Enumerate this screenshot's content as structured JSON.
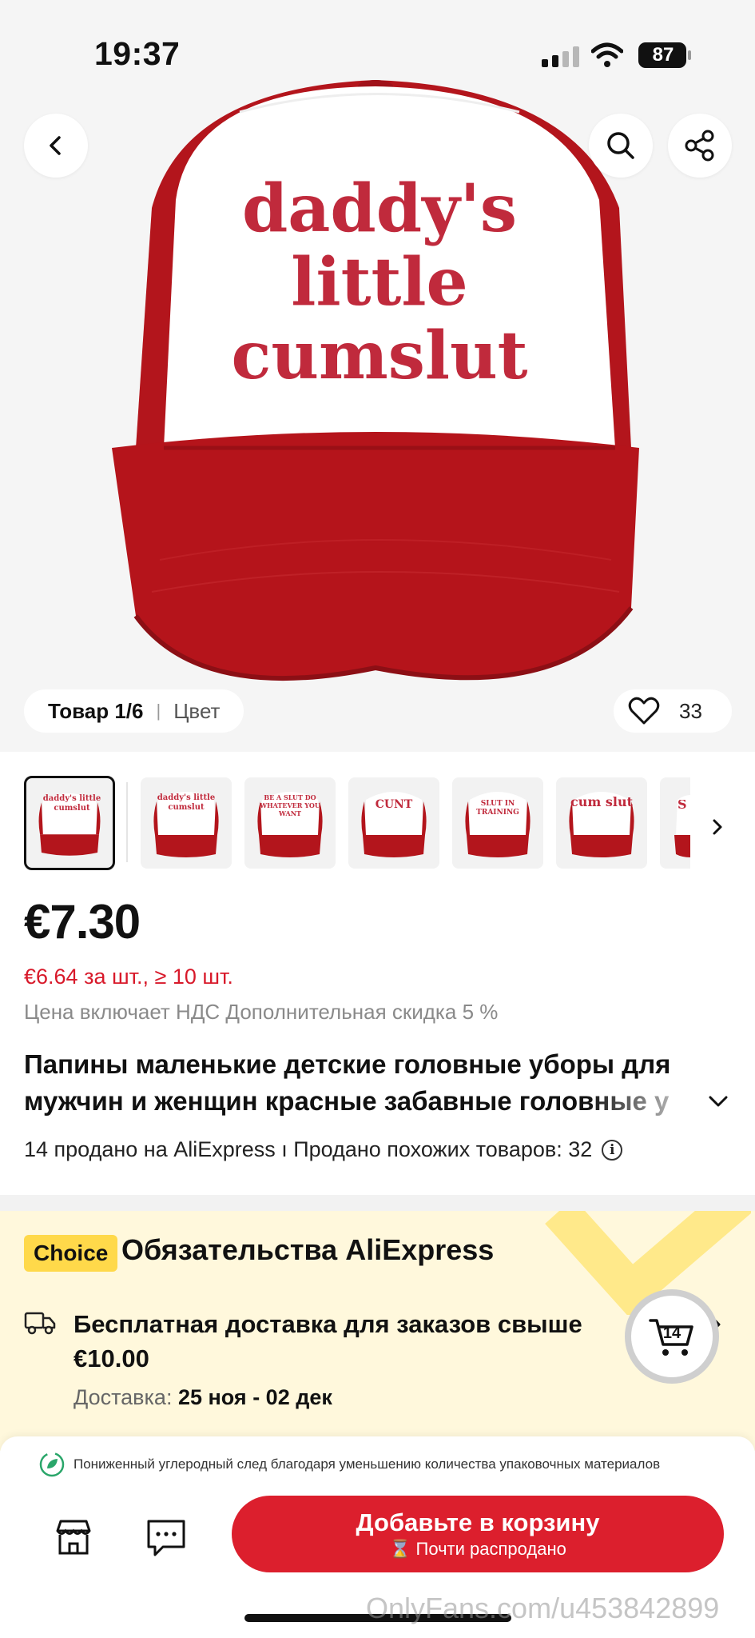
{
  "status_bar": {
    "time": "19:37",
    "battery": "87"
  },
  "hero": {
    "hat_print_lines": [
      "daddy's",
      "little",
      "cumslut"
    ],
    "counter_label": "Товар 1/6",
    "counter_separator": "|",
    "color_label": "Цвет",
    "likes": "33",
    "icons": [
      "chevron-left-icon",
      "search-icon",
      "share-icon",
      "heart-icon"
    ]
  },
  "thumbnails": [
    {
      "label": "daddy's little cumslut",
      "selected": true
    },
    {
      "label": "daddy's little cumslut",
      "selected": false
    },
    {
      "label": "BE A SLUT DO WHATEVER YOU WANT",
      "selected": false
    },
    {
      "label": "CUNT",
      "selected": false
    },
    {
      "label": "SLUT IN TRAINING",
      "selected": false
    },
    {
      "label": "cum slut",
      "selected": false
    },
    {
      "label": "S",
      "selected": false
    }
  ],
  "product": {
    "price": "€7.30",
    "bulk_price": "€6.64 за шт., ≥ 10 шт.",
    "vat_note": "Цена включает НДС Дополнительная скидка 5 %",
    "title_line1": "Папины маленькие детские головные уборы для",
    "title_line2": "мужчин и женщин красные забавные головные у",
    "sold_text": "14 продано на AliExpress ı Продано похожих товаров: 32",
    "info_glyph": "i"
  },
  "choice": {
    "badge": "Choice",
    "title": "Обязательства AliExpress",
    "delivery_title": "Бесплатная доставка для заказов свыше €10.00",
    "delivery_label": "Доставка: ",
    "delivery_dates": "25 ноя - 02 дек"
  },
  "cart": {
    "count": "14"
  },
  "bottom_bar": {
    "eco_text": "Пониженный углеродный след благодаря уменьшению количества упаковочных материалов",
    "add_to_cart": "Добавьте в корзину",
    "almost_sold_out": "Почти распродано",
    "almost_sold_out_glyph": "⌛"
  },
  "watermark": "OnlyFans.com/u453842899",
  "colors": {
    "accent_red": "#dc1f2d",
    "price_red": "#d8192a",
    "choice_yellow": "#ffd94a",
    "choice_bg": "#fff8dc",
    "hat_red": "#b3151c"
  }
}
